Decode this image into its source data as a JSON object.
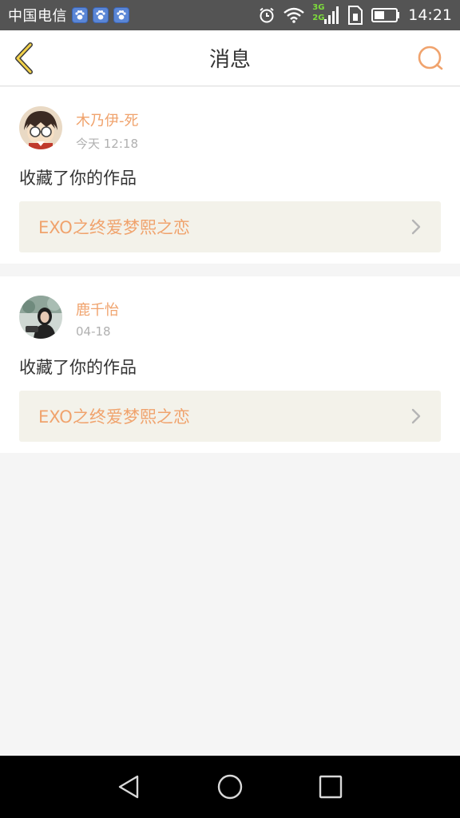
{
  "status_bar": {
    "carrier": "中国电信",
    "network_top": "3G",
    "network_bottom": "2G",
    "time": "14:21",
    "icons": [
      "paw-icon",
      "paw-icon",
      "paw-icon",
      "alarm-icon",
      "wifi-icon",
      "signal-icon",
      "sim-icon",
      "battery-icon"
    ]
  },
  "header": {
    "title": "消息",
    "left_icon": "back-chevron-icon",
    "right_icon": "search-icon",
    "accent_color": "#f0a36d"
  },
  "messages": [
    {
      "username": "木乃伊-死",
      "time": "今天 12:18",
      "action": "收藏了你的作品",
      "work_title": "EXO之终爱梦熙之恋"
    },
    {
      "username": "鹿千怡",
      "time": "04-18",
      "action": "收藏了你的作品",
      "work_title": "EXO之终爱梦熙之恋"
    }
  ],
  "nav_bar": {
    "icons": [
      "back-triangle-icon",
      "home-circle-icon",
      "recents-square-icon"
    ]
  }
}
